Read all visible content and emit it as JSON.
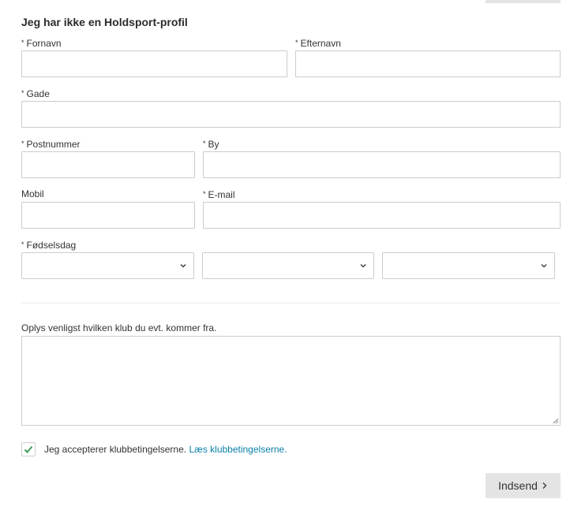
{
  "form": {
    "title": "Jeg har ikke en Holdsport-profil",
    "required_mark": "*",
    "fields": {
      "fornavn": {
        "label": "Fornavn",
        "value": ""
      },
      "efternavn": {
        "label": "Efternavn",
        "value": ""
      },
      "gade": {
        "label": "Gade",
        "value": ""
      },
      "postnummer": {
        "label": "Postnummer",
        "value": ""
      },
      "by": {
        "label": "By",
        "value": ""
      },
      "mobil": {
        "label": "Mobil",
        "value": ""
      },
      "email": {
        "label": "E-mail",
        "value": ""
      },
      "birthday": {
        "label": "Fødselsdag",
        "day": "",
        "month": "",
        "year": ""
      }
    },
    "club_note": {
      "label": "Oplys venligst hvilken klub du evt. kommer fra.",
      "value": ""
    },
    "terms": {
      "checked": true,
      "text": "Jeg accepterer klubbetingelserne.",
      "link": "Læs klubbetingelserne."
    },
    "submit_label": "Indsend",
    "icons": {
      "select": "chevron-down-icon",
      "submit": "chevron-right-icon",
      "checkbox": "checkmark-icon"
    },
    "colors": {
      "accent": "#0a7fa8",
      "check": "#3c9b5c",
      "button_bg": "#e4e4e4",
      "border": "#cccccc"
    }
  }
}
